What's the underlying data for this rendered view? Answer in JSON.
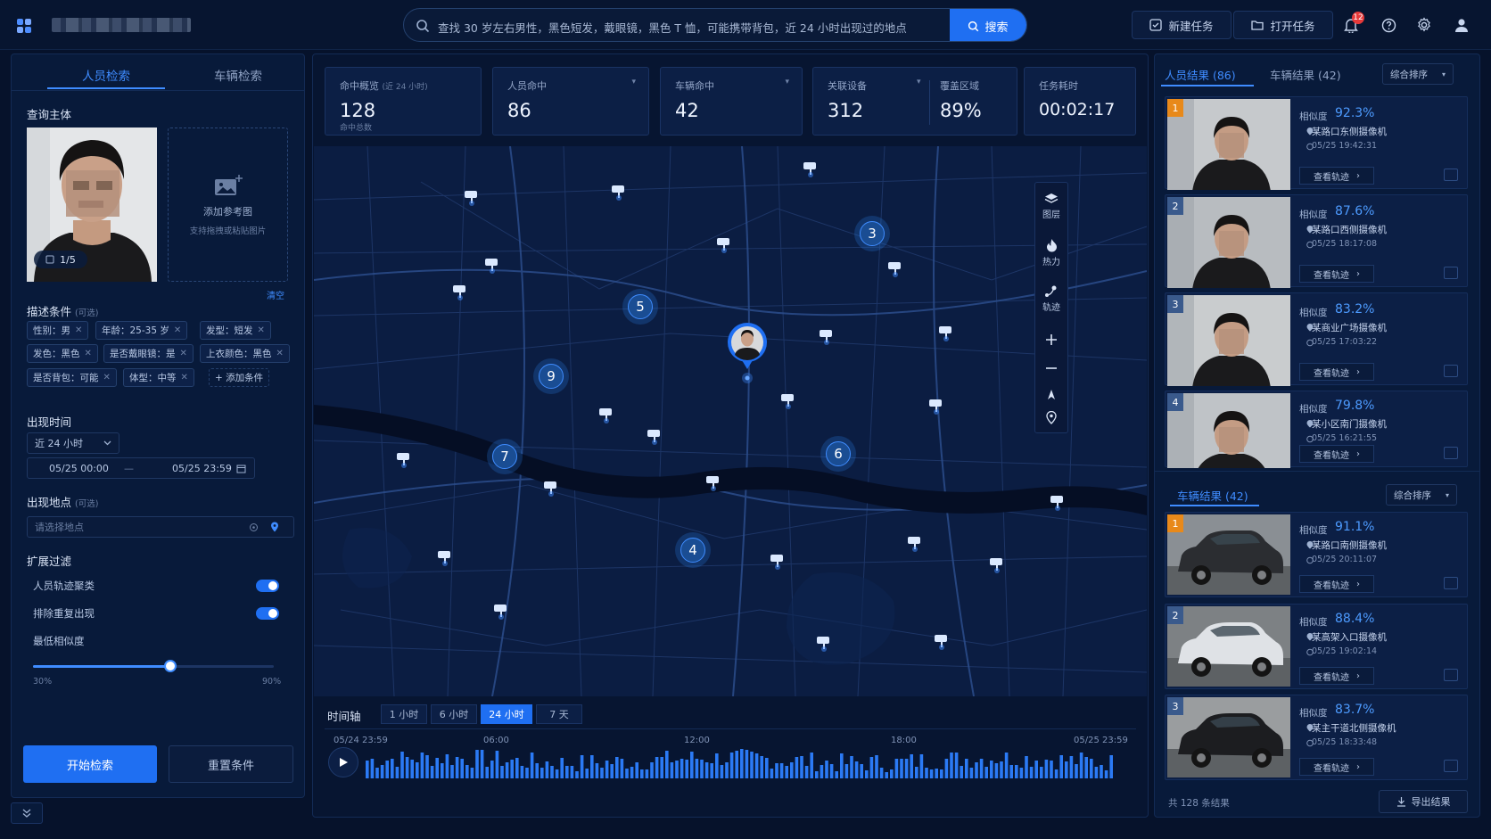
{
  "header": {
    "search_query": "查找 30 岁左右男性，黑色短发，戴眼镜，黑色 T 恤，可能携带背包，近 24 小时出现过的地点",
    "search_button": "搜索",
    "new_task": "新建任务",
    "open_task": "打开任务",
    "notification_count": "12"
  },
  "left": {
    "tabs": [
      "人员检索",
      "车辆检索"
    ],
    "subject_title": "查询主体",
    "photo_counter": "1/5",
    "add_ref_title": "添加参考图",
    "add_ref_hint": "支持拖拽或粘贴图片",
    "clear": "清空",
    "desc_title": "描述条件",
    "desc_optional": "(可选)",
    "chips": [
      "性别：男",
      "年龄：25-35 岁",
      "发型：短发",
      "发色：黑色",
      "是否戴眼镜：是",
      "上衣颜色：黑色",
      "是否背包：可能",
      "体型：中等"
    ],
    "add_condition": "+ 添加条件",
    "time_title": "出现时间",
    "time_range": "近 24 小时",
    "date_from": "05/25 00:00",
    "date_sep": "—",
    "date_to": "05/25 23:59",
    "place_title": "出现地点",
    "place_optional": "(可选)",
    "place_placeholder": "请选择地点",
    "filter_title": "扩展过滤",
    "filter_cluster": "人员轨迹聚类",
    "filter_dedupe": "排除重复出现",
    "filter_similarity": "最低相似度",
    "slider_min": "30%",
    "slider_max": "90%",
    "slider_value": 0.57,
    "start_button": "开始检索",
    "reset_button": "重置条件"
  },
  "stats": {
    "hits_label": "命中概览",
    "hits_sub": "(近 24 小时)",
    "hits_value": "128",
    "hits_caption": "命中总数",
    "person_label": "人员命中",
    "person_value": "86",
    "vehicle_label": "车辆命中",
    "vehicle_value": "42",
    "device_label": "关联设备",
    "device_value": "312",
    "coverage_label": "覆盖区域",
    "coverage_value": "89%",
    "duration_label": "任务耗时",
    "duration_value": "00:02:17"
  },
  "map": {
    "clusters": [
      "3",
      "5",
      "9",
      "7",
      "6",
      "4"
    ],
    "tools": [
      "图层",
      "热力",
      "轨迹"
    ]
  },
  "timeline": {
    "title": "时间轴",
    "ranges": [
      "1 小时",
      "6 小时",
      "24 小时",
      "7 天"
    ],
    "ticks": [
      "05/24 23:59",
      "06:00",
      "12:00",
      "18:00",
      "05/25 23:59"
    ]
  },
  "right": {
    "person_tab": "人员结果 (86)",
    "vehicle_tab": "车辆结果 (42)",
    "sort": "综合排序",
    "vehicle_section": "车辆结果 (42)",
    "sim_label": "相似度",
    "track_label": "查看轨迹",
    "persons": [
      {
        "rank": "1",
        "sim": "92.3%",
        "loc": "某路口东侧摄像机",
        "time": "05/25 19:42:31"
      },
      {
        "rank": "2",
        "sim": "87.6%",
        "loc": "某路口西侧摄像机",
        "time": "05/25 18:17:08"
      },
      {
        "rank": "3",
        "sim": "83.2%",
        "loc": "某商业广场摄像机",
        "time": "05/25 17:03:22"
      },
      {
        "rank": "4",
        "sim": "79.8%",
        "loc": "某小区南门摄像机",
        "time": "05/25 16:21:55"
      }
    ],
    "vehicles": [
      {
        "rank": "1",
        "sim": "91.1%",
        "loc": "某路口南侧摄像机",
        "time": "05/25 20:11:07"
      },
      {
        "rank": "2",
        "sim": "88.4%",
        "loc": "某高架入口摄像机",
        "time": "05/25 19:02:14"
      },
      {
        "rank": "3",
        "sim": "83.7%",
        "loc": "某主干道北侧摄像机",
        "time": "05/25 18:33:48"
      }
    ],
    "total": "共 128 条结果",
    "export": "导出结果"
  },
  "colors": {
    "accent": "#1f6ff2",
    "rank1": "#e8891a",
    "rank_other": "#3a5a8c"
  }
}
